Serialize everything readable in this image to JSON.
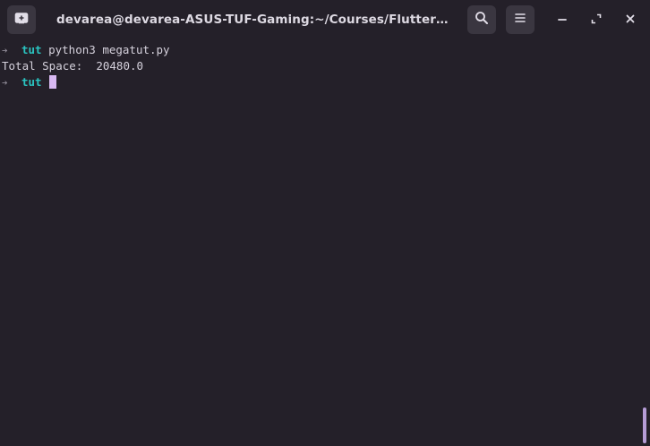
{
  "window": {
    "title": "devarea@devarea-ASUS-TUF-Gaming:~/Courses/Flutter/moviea...",
    "icons": {
      "new_tab": "new-tab-icon",
      "search": "search-icon",
      "menu": "hamburger-menu-icon",
      "minimize": "minimize-icon",
      "maximize": "maximize-icon",
      "close": "close-icon"
    }
  },
  "terminal": {
    "lines": [
      {
        "arrow": "➔",
        "dir": "tut",
        "command": "python3 megatut.py"
      },
      {
        "output": "Total Space:  20480.0"
      },
      {
        "arrow": "➔",
        "dir": "tut",
        "command": ""
      }
    ]
  },
  "colors": {
    "background": "#242029",
    "prompt_dir": "#2ac3c0",
    "cursor": "#d8b8f2",
    "scrollbar": "#b59cd6"
  }
}
